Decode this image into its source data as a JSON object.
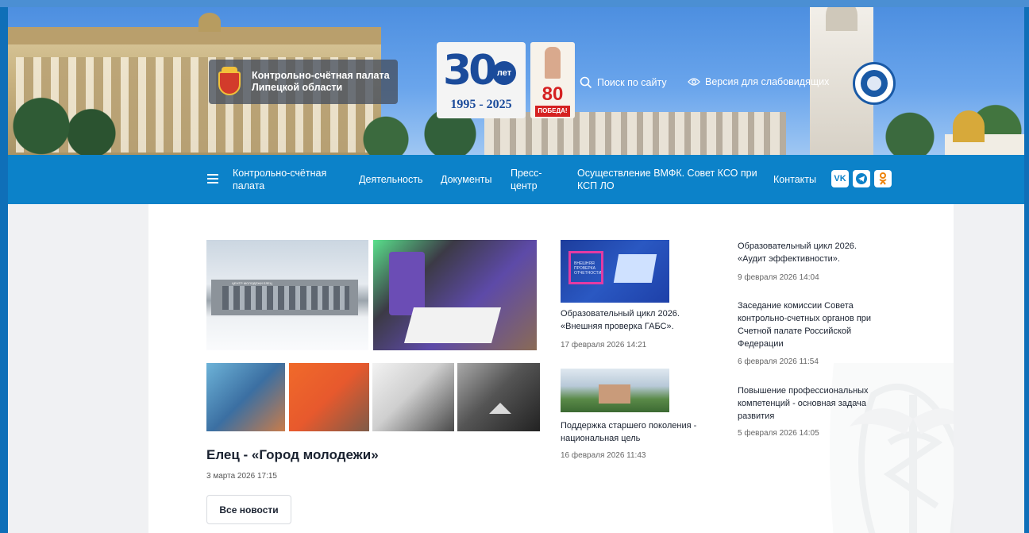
{
  "header": {
    "org_name_line1": "Контрольно-счётная палата",
    "org_name_line2": "Липецкой области",
    "anniversary_number": "30",
    "anniversary_word": "лет",
    "anniversary_years": "1995 - 2025",
    "victory_number": "80",
    "victory_word": "ПОБЕДА!",
    "search_label": "Поиск по сайту",
    "accessibility_label": "Версия для слабовидящих"
  },
  "nav": {
    "items": [
      {
        "label": "Контрольно-счётная палата"
      },
      {
        "label": "Деятельность"
      },
      {
        "label": "Документы"
      },
      {
        "label": "Пресс-центр"
      },
      {
        "label": "Осуществление ВМФК. Совет КСО при КСП ЛО"
      },
      {
        "label": "Контакты"
      }
    ],
    "social": [
      {
        "label": "VK",
        "icon": "vk-icon",
        "color": "#0077ff"
      },
      {
        "label": "Telegram",
        "icon": "telegram-icon",
        "color": "#229ed9"
      },
      {
        "label": "OK",
        "icon": "odnoklassniki-icon",
        "color": "#ee8208"
      }
    ]
  },
  "main_news": {
    "title": "Елец - «Город молодежи»",
    "date": "3 марта 2026 17:15",
    "sign_text": "ЦЕНТР МОЛОДЕЖИ ЕЛЕЦ",
    "all_news_label": "Все новости"
  },
  "news_middle": [
    {
      "title_line1": "Образовательный цикл 2026.",
      "title_line2": "«Внешняя проверка ГАБС».",
      "date": "17 февраля 2026 14:21",
      "thumb_text": "ВНЕШНЯЯ ПРОВЕРКА ОТЧЕТНОСТИ"
    },
    {
      "title_line1": "Поддержка старшего поколения -",
      "title_line2": "национальная цель",
      "date": "16 февраля 2026 11:43"
    }
  ],
  "news_right": [
    {
      "lines": [
        "Образовательный цикл 2026.",
        "«Аудит эффективности»."
      ],
      "date": "9 февраля 2026 14:04"
    },
    {
      "lines": [
        "Заседание комиссии Совета",
        "контрольно-счетных органов при",
        "Счетной палате Российской",
        "Федерации"
      ],
      "date": "6 февраля 2026 11:54"
    },
    {
      "lines": [
        "Повышение профессиональных",
        "компетенций - основная задача",
        "развития"
      ],
      "date": "5 февраля 2026 14:05"
    }
  ],
  "colors": {
    "nav_bg": "#0c82c9",
    "hero_sky": "#4d8fe0",
    "page_bg": "#f0f1f3",
    "content_bg": "#ffffff",
    "text_dark": "#1a2230"
  }
}
